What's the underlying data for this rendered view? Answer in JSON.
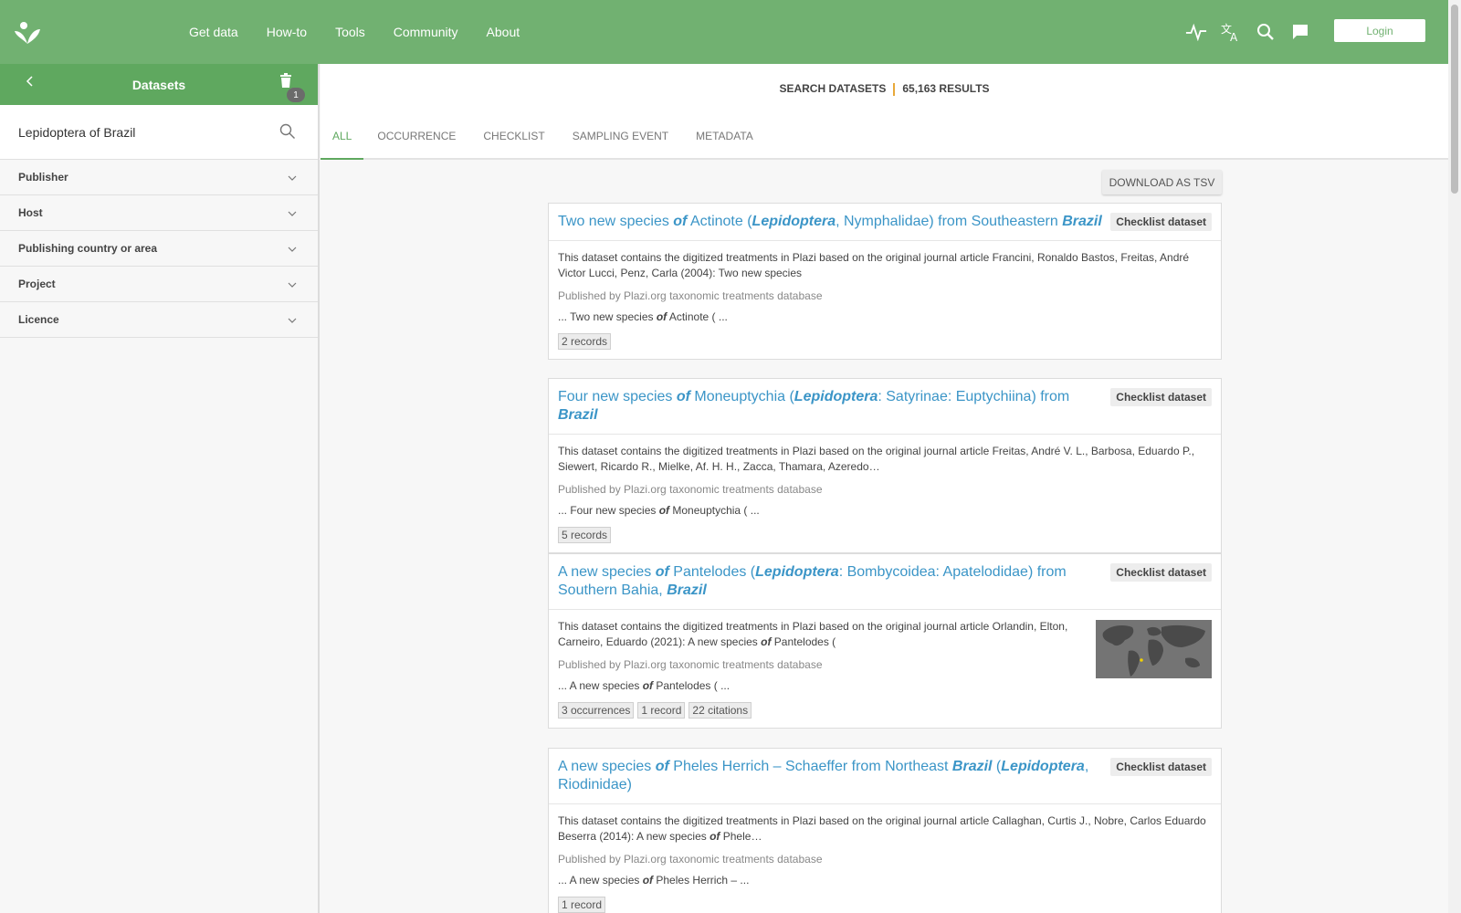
{
  "nav": {
    "items": [
      "Get data",
      "How-to",
      "Tools",
      "Community",
      "About"
    ],
    "login_label": "Login",
    "icons": [
      "activity-icon",
      "translate-icon",
      "search-icon",
      "feedback-icon"
    ]
  },
  "sidebar": {
    "title": "Datasets",
    "filter_count": "1",
    "search_value": "Lepidoptera of Brazil",
    "facets": [
      "Publisher",
      "Host",
      "Publishing country or area",
      "Project",
      "Licence"
    ]
  },
  "results": {
    "label": "SEARCH DATASETS",
    "count": "65,163 RESULTS"
  },
  "tabs": [
    "ALL",
    "OCCURRENCE",
    "CHECKLIST",
    "SAMPLING EVENT",
    "METADATA"
  ],
  "download_label": "DOWNLOAD AS TSV",
  "cards": [
    {
      "type": "Checklist dataset",
      "desc": "This dataset contains the digitized treatments in Plazi based on the original journal article Francini, Ronaldo Bastos, Freitas, André Victor Lucci, Penz, Carla (2004): Two new species",
      "publisher": "Published by Plazi.org taxonomic treatments database",
      "chips": [
        "2 records"
      ]
    },
    {
      "type": "Checklist dataset",
      "desc": "This dataset contains the digitized treatments in Plazi based on the original journal article Freitas, André V. L., Barbosa, Eduardo P., Siewert, Ricardo R., Mielke, Af. H. H., Zacca, Thamara, Azeredo…",
      "publisher": "Published by Plazi.org taxonomic treatments database",
      "chips": [
        "5 records"
      ]
    },
    {
      "type": "Checklist dataset",
      "publisher": "Published by Plazi.org taxonomic treatments database",
      "chips": [
        "3 occurrences",
        "1 record",
        "22 citations"
      ]
    },
    {
      "type": "Checklist dataset",
      "publisher": "Published by Plazi.org taxonomic treatments database",
      "chips": [
        "1 record"
      ]
    }
  ],
  "colors": {
    "header": "#71b171",
    "accent": "#5fa85f",
    "link": "#3b95c7",
    "divider": "#e8a93a"
  }
}
